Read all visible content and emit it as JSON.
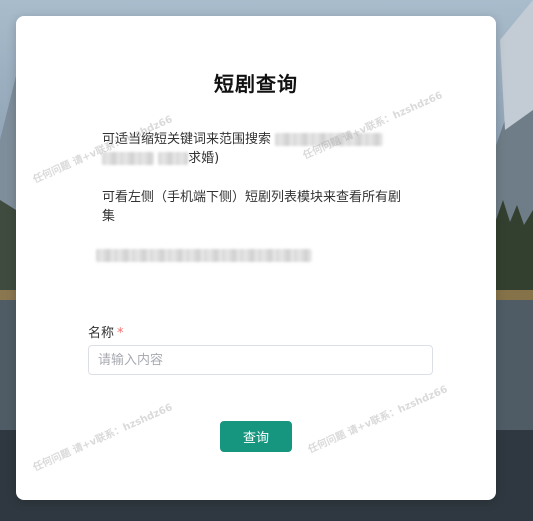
{
  "title": "短剧查询",
  "desc1": {
    "prefix": "可适当缩短关键词来范围搜索",
    "suffix": "求婚)"
  },
  "desc2": "可看左侧（手机端下侧）短剧列表模块来查看所有剧集",
  "form": {
    "label": "名称",
    "required_mark": "*",
    "placeholder": "请输入内容",
    "value": ""
  },
  "button": "查询",
  "watermark": "任何问题 请+v联系：hzshdz66"
}
